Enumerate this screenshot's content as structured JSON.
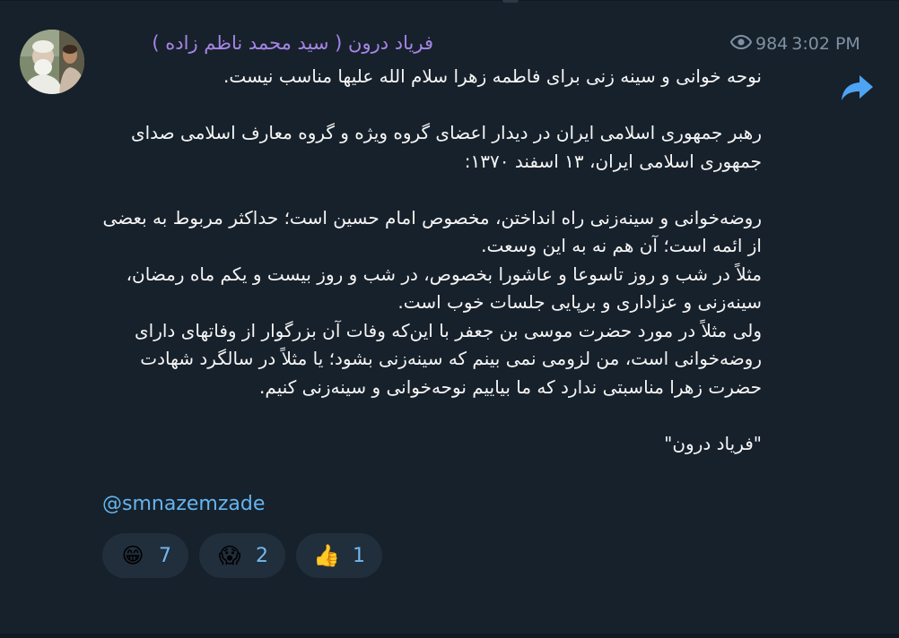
{
  "post": {
    "author": "فریاد درون ( سید محمد ناظم زاده )",
    "views": "984",
    "time": "3:02 PM",
    "message": [
      "نوحه خوانی و سینه زنی برای فاطمه زهرا سلام الله علیها مناسب نیست.",
      "رهبر جمهوری اسلامی ایران در دیدار اعضای گروه ویژه و گروه معارف اسلامی صدای جمهوری اسلامی ایران، ۱۳ اسفند ۱۳۷۰:",
      "روضه‌خوانی و سینه‌زنی راه انداختن، مخصوص امام حسین است؛ حداکثر مربوط به بعضی از ائمه است؛ آن هم نه به این وسعت.\nمثلاً در شب و روز تاسوعا و عاشورا بخصوص، در شب و روز بیست و یکم ماه رمضان، سینه‌زنی و عزاداری و برپایی جلسات خوب است.\nولی مثلاً در مورد حضرت موسی بن جعفر با این‌که وفات آن بزرگوار از وفاتهای دارای روضه‌خوانی است، من لزومی نمی بینم که سینه‌زنی بشود؛ یا مثلاً در سالگرد شهادت حضرت زهرا مناسبتی ندارد که ما بیاییم نوحه‌خوانی و سینه‌زنی کنیم.",
      "\"فریاد درون\""
    ],
    "mention": "@smnazemzade"
  },
  "reactions": [
    {
      "emoji": "😁",
      "icon": "grinning-face-icon",
      "count": "7"
    },
    {
      "emoji": "😱",
      "icon": "screaming-face-icon",
      "count": "2"
    },
    {
      "emoji": "👍",
      "icon": "thumbs-up-icon",
      "count": "1"
    }
  ],
  "colors": {
    "background": "#17212b",
    "author": "#a585e6",
    "link": "#64b5ef",
    "share": "#4ea4f2",
    "reaction_bg": "#212e3c"
  }
}
